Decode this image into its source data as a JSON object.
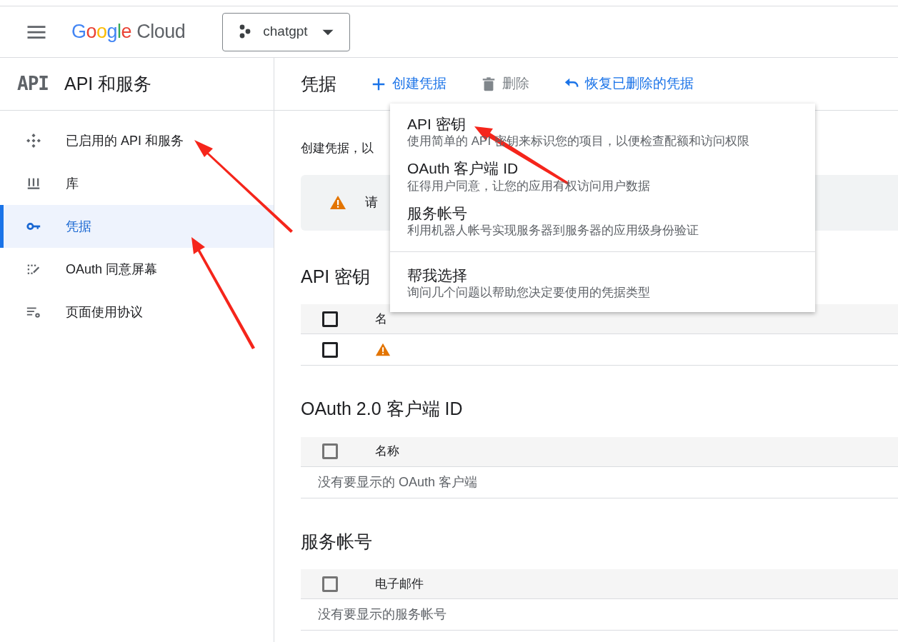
{
  "header": {
    "logo": "Google Cloud",
    "project": "chatgpt"
  },
  "sidebar": {
    "badge": "API",
    "title": "API 和服务",
    "items": [
      {
        "label": "已启用的 API 和服务",
        "selected": false
      },
      {
        "label": "库",
        "selected": false
      },
      {
        "label": "凭据",
        "selected": true
      },
      {
        "label": "OAuth 同意屏幕",
        "selected": false
      },
      {
        "label": "页面使用协议",
        "selected": false
      }
    ]
  },
  "toolbar": {
    "title": "凭据",
    "actions": [
      {
        "label": "创建凭据",
        "disabled": false
      },
      {
        "label": "删除",
        "disabled": true
      },
      {
        "label": "恢复已删除的凭据",
        "disabled": false
      }
    ]
  },
  "intro": "创建凭据，以",
  "alert": "请",
  "sections": [
    {
      "heading": "API 密钥",
      "column": "名",
      "header_checkbox": {
        "checked": false,
        "disabled": false
      },
      "rows": [
        {
          "kind": "item",
          "checked": false
        }
      ]
    },
    {
      "heading": "OAuth 2.0 客户端 ID",
      "column": "名称",
      "header_checkbox": {
        "checked": false,
        "disabled": true
      },
      "rows": [
        {
          "kind": "empty",
          "text": "没有要显示的 OAuth 客户端"
        }
      ]
    },
    {
      "heading": "服务帐号",
      "column": "电子邮件",
      "header_checkbox": {
        "checked": false,
        "disabled": true
      },
      "rows": [
        {
          "kind": "empty",
          "text": "没有要显示的服务帐号"
        }
      ]
    }
  ],
  "menu": {
    "groups": [
      [
        {
          "title": "API 密钥",
          "description": "使用简单的 API 密钥来标识您的项目，以便检查配额和访问权限"
        },
        {
          "title": "OAuth 客户端 ID",
          "description": "征得用户同意，让您的应用有权访问用户数据"
        },
        {
          "title": "服务帐号",
          "description": "利用机器人帐号实现服务器到服务器的应用级身份验证"
        }
      ],
      [
        {
          "title": "帮我选择",
          "description": "询问几个问题以帮助您决定要使用的凭据类型"
        }
      ]
    ]
  }
}
